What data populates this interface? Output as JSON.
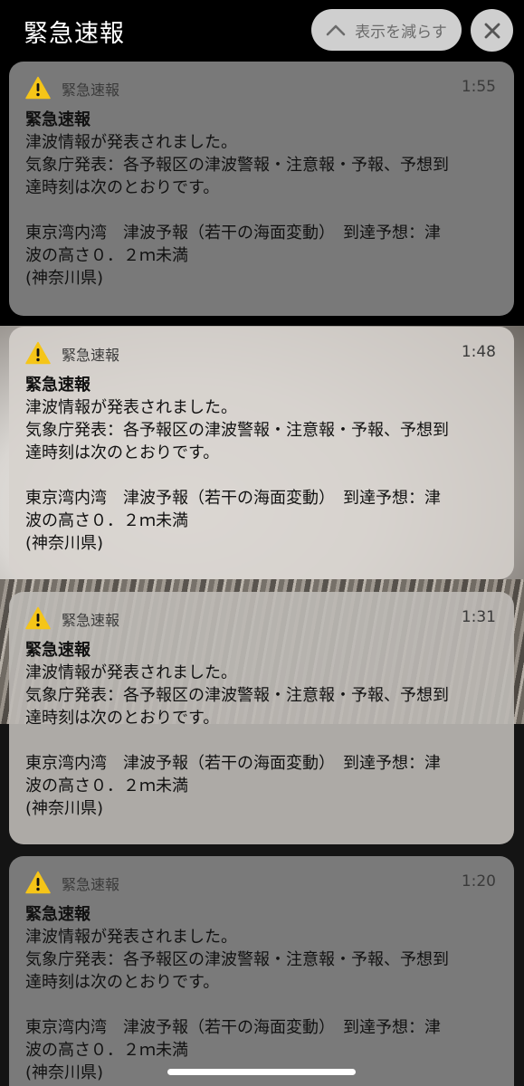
{
  "header": {
    "title": "緊急速報",
    "collapse_label": "表示を減らす"
  },
  "notifications": [
    {
      "app": "緊急速報",
      "time": "1:55",
      "title": "緊急速報",
      "line1": "津波情報が発表されました。",
      "line2": "気象庁発表：各予報区の津波警報・注意報・予報、予想到",
      "line3": "達時刻は次のとおりです。",
      "line4": "東京湾内湾　津波予報（若干の海面変動）　到達予想：津",
      "line5": "波の高さ０．２ｍ未満",
      "line6": "(神奈川県)"
    },
    {
      "app": "緊急速報",
      "time": "1:48",
      "title": "緊急速報",
      "line1": "津波情報が発表されました。",
      "line2": "気象庁発表：各予報区の津波警報・注意報・予報、予想到",
      "line3": "達時刻は次のとおりです。",
      "line4": "東京湾内湾　津波予報（若干の海面変動）　到達予想：津",
      "line5": "波の高さ０．２ｍ未満",
      "line6": "(神奈川県)"
    },
    {
      "app": "緊急速報",
      "time": "1:31",
      "title": "緊急速報",
      "line1": "津波情報が発表されました。",
      "line2": "気象庁発表：各予報区の津波警報・注意報・予報、予想到",
      "line3": "達時刻は次のとおりです。",
      "line4": "東京湾内湾　津波予報（若干の海面変動）　到達予想：津",
      "line5": "波の高さ０．２ｍ未満",
      "line6": "(神奈川県)"
    },
    {
      "app": "緊急速報",
      "time": "1:20",
      "title": "緊急速報",
      "line1": "津波情報が発表されました。",
      "line2": "気象庁発表：各予報区の津波警報・注意報・予報、予想到",
      "line3": "達時刻は次のとおりです。",
      "line4": "東京湾内湾　津波予報（若干の海面変動）　到達予想：津",
      "line5": "波の高さ０．２ｍ未満",
      "line6": "(神奈川県)"
    }
  ],
  "icons": {
    "warning": "warning-triangle-icon",
    "collapse": "chevron-up-icon",
    "close": "close-icon"
  },
  "colors": {
    "warning_yellow": "#f5c518",
    "card_gray": "#828282",
    "button_bg": "#cfcfcf"
  }
}
